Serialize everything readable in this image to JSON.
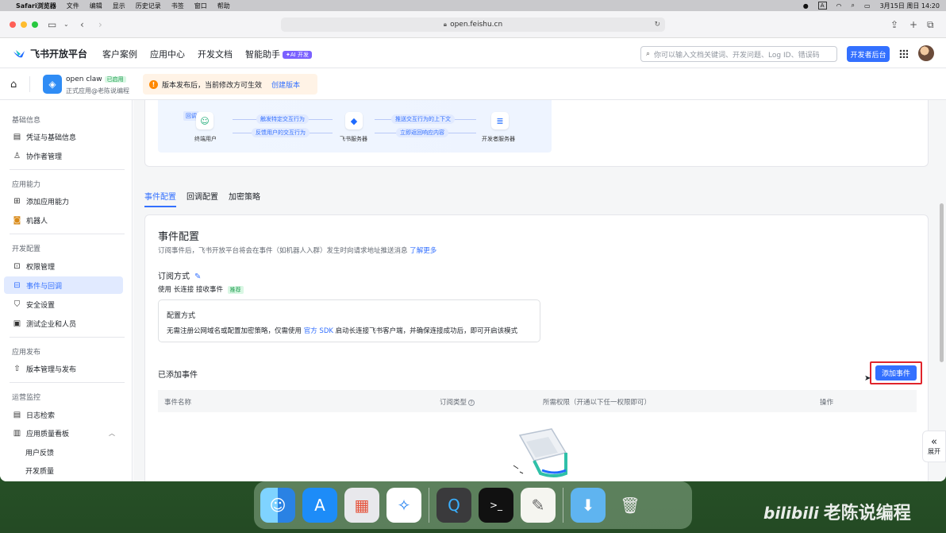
{
  "menubar": {
    "app": "Safari浏览器",
    "items": [
      "文件",
      "编辑",
      "显示",
      "历史记录",
      "书签",
      "窗口",
      "帮助"
    ],
    "input_indicator": "A",
    "datetime": "3月15日 周日 14:20"
  },
  "browser": {
    "url": "open.feishu.cn"
  },
  "topnav": {
    "brand": "飞书开放平台",
    "links": [
      "客户案例",
      "应用中心",
      "开发文档",
      "智能助手"
    ],
    "ai_badge": "✦AI 开发",
    "search_placeholder": "你可以输入文档关键词、开发问题、Log ID、错误码",
    "dev_console": "开发者后台"
  },
  "app": {
    "name": "open claw",
    "status": "已启用",
    "subtitle": "正式应用@老陈说编程",
    "notice": "版本发布后，当前修改方可生效",
    "notice_action": "创建版本"
  },
  "sidebar": {
    "sections": [
      {
        "title": "基础信息",
        "items": [
          {
            "label": "凭证与基础信息",
            "icon": "credential-icon"
          },
          {
            "label": "协作者管理",
            "icon": "user-icon"
          }
        ]
      },
      {
        "title": "应用能力",
        "items": [
          {
            "label": "添加应用能力",
            "icon": "grid-add-icon"
          },
          {
            "label": "机器人",
            "icon": "robot-icon"
          }
        ]
      },
      {
        "title": "开发配置",
        "items": [
          {
            "label": "权限管理",
            "icon": "lock-icon"
          },
          {
            "label": "事件与回调",
            "icon": "event-icon",
            "active": true
          },
          {
            "label": "安全设置",
            "icon": "shield-icon"
          },
          {
            "label": "测试企业和人员",
            "icon": "test-icon"
          }
        ]
      },
      {
        "title": "应用发布",
        "items": [
          {
            "label": "版本管理与发布",
            "icon": "upload-icon"
          }
        ]
      },
      {
        "title": "运营监控",
        "items": [
          {
            "label": "日志检索",
            "icon": "log-icon"
          },
          {
            "label": "应用质量看板",
            "icon": "chart-icon"
          },
          {
            "label": "用户反馈"
          },
          {
            "label": "开发质量"
          }
        ]
      }
    ]
  },
  "diagram": {
    "tag": "回调",
    "nodes": [
      "终端用户",
      "飞书服务器",
      "开发者服务器"
    ],
    "arrows": [
      "触发特定交互行为",
      "反馈用户的交互行为",
      "推送交互行为的上下文",
      "立即返回响应内容"
    ]
  },
  "tabs": [
    "事件配置",
    "回调配置",
    "加密策略"
  ],
  "config": {
    "title": "事件配置",
    "desc": "订阅事件后，飞书开放平台将会在事件（如机器人入群）发生时向请求地址推送消息",
    "learn_more": "了解更多",
    "sub_mode_title": "订阅方式",
    "use_prefix": "使用",
    "use_mode": "长连接",
    "use_suffix": "接收事件",
    "recommended": "推荐",
    "mode_box_title": "配置方式",
    "mode_box_desc_a": "无需注册公网域名或配置加密策略，仅需使用",
    "mode_box_link": "官方 SDK",
    "mode_box_desc_b": "启动长连接飞书客户端，并确保连接成功后，即可开启该模式",
    "added_title": "已添加事件",
    "add_button": "添加事件",
    "columns": [
      "事件名称",
      "订阅类型",
      "所需权限（开通以下任一权限即可）",
      "操作"
    ]
  },
  "expand_label": "展开",
  "watermark": {
    "logo": "bilibili",
    "text": "老陈说编程"
  }
}
